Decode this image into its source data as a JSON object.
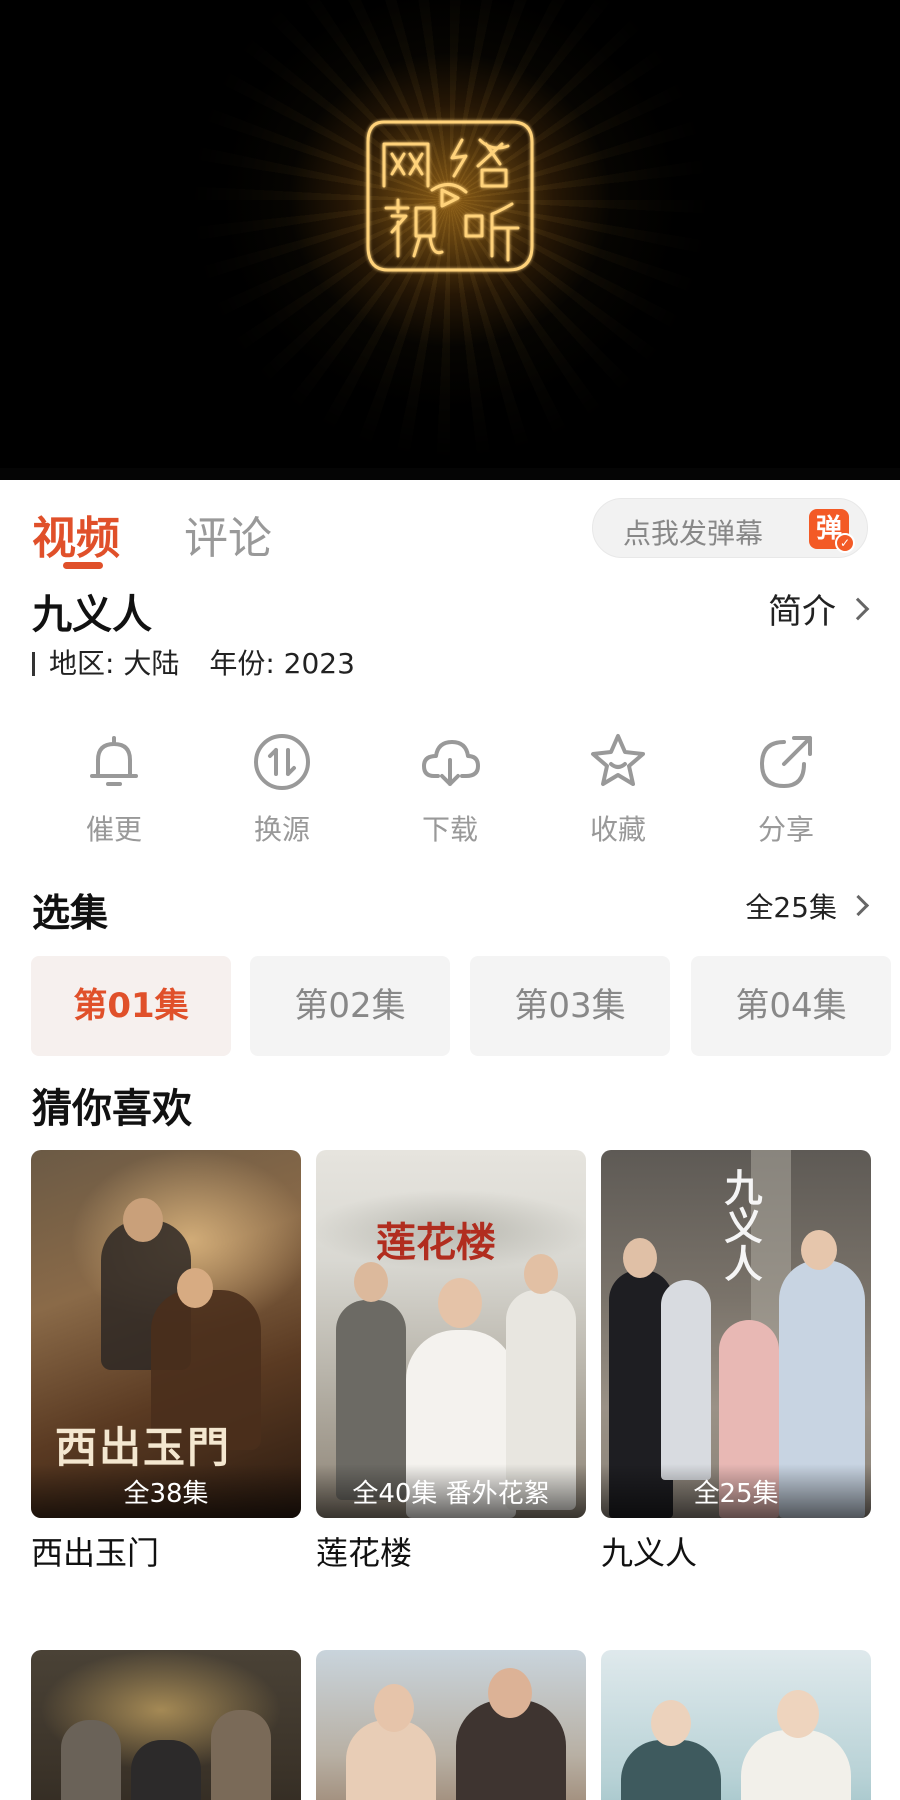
{
  "player": {
    "logo_icon": "wangluo-shiting-logo",
    "logo_chars": [
      "网",
      "络",
      "视",
      "听"
    ],
    "accent": "#f0a030"
  },
  "tabs": {
    "video": "视频",
    "comment": "评论"
  },
  "danmu": {
    "placeholder": "点我发弹幕",
    "icon_label": "弹",
    "accent": "#f35a26"
  },
  "show": {
    "title": "九义人",
    "intro_label": "简介",
    "region": "地区: 大陆",
    "year": "年份: 2023"
  },
  "actions": [
    {
      "label": "催更",
      "icon": "bell-icon"
    },
    {
      "label": "换源",
      "icon": "switch-source-icon"
    },
    {
      "label": "下载",
      "icon": "cloud-download-icon"
    },
    {
      "label": "收藏",
      "icon": "star-icon"
    },
    {
      "label": "分享",
      "icon": "share-icon"
    }
  ],
  "episodes": {
    "title": "选集",
    "all_label": "全25集",
    "items": [
      "第01集",
      "第02集",
      "第03集",
      "第04集"
    ],
    "active_index": 0
  },
  "recommend": {
    "title": "猜你喜欢",
    "items": [
      {
        "name": "西出玉门",
        "badge": "全38集",
        "poster_title": "西出玉門"
      },
      {
        "name": "莲花楼",
        "badge": "全40集 番外花絮",
        "poster_title": "莲花楼"
      },
      {
        "name": "九义人",
        "badge": "全25集",
        "poster_title": "九义人"
      }
    ]
  },
  "colors": {
    "accent": "#e0502a"
  }
}
